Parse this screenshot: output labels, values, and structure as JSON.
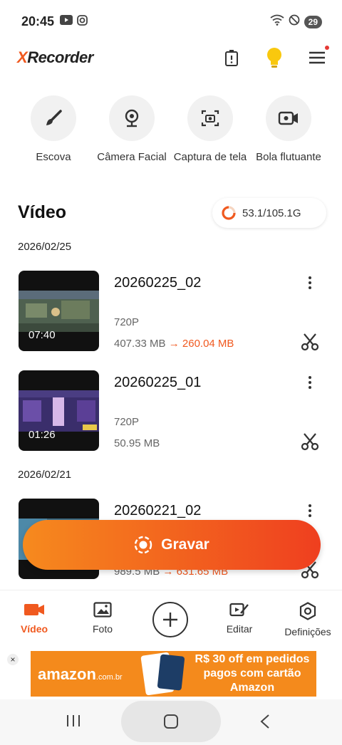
{
  "status_bar": {
    "time": "20:45",
    "battery": "29"
  },
  "app": {
    "logo_x": "X",
    "logo_rest": "Recorder"
  },
  "tools": [
    {
      "label": "Escova",
      "icon": "brush-icon"
    },
    {
      "label": "Câmera Facial",
      "icon": "webcam-icon"
    },
    {
      "label": "Captura de tela",
      "icon": "screenshot-icon"
    },
    {
      "label": "Bola flutuante",
      "icon": "floating-camera-icon"
    }
  ],
  "section": {
    "title": "Vídeo",
    "storage": "53.1/105.1G"
  },
  "groups": [
    {
      "date": "2026/02/25",
      "videos": [
        {
          "name": "20260225_02",
          "duration": "07:40",
          "resolution": "720P",
          "size": "407.33 MB",
          "arrow": "→",
          "compressed": "260.04 MB"
        },
        {
          "name": "20260225_01",
          "duration": "01:26",
          "resolution": "720P",
          "size": "50.95 MB"
        }
      ]
    },
    {
      "date": "2026/02/21",
      "videos": [
        {
          "name": "20260221_02",
          "size": "989.5 MB",
          "arrow": "→",
          "compressed": "631.65 MB"
        }
      ]
    }
  ],
  "record_button": {
    "label": "Gravar"
  },
  "bottom_nav": [
    {
      "label": "Vídeo",
      "icon": "video-camera-icon",
      "active": true
    },
    {
      "label": "Foto",
      "icon": "photo-icon"
    },
    {
      "label": "",
      "icon": "plus-icon"
    },
    {
      "label": "Editar",
      "icon": "edit-video-icon"
    },
    {
      "label": "Definições",
      "icon": "settings-hexagon-icon"
    }
  ],
  "ad": {
    "close": "×",
    "brand": "amazon",
    "brand_suffix": ".com.br",
    "text": "R$ 30 off em pedidos pagos com cartão Amazon"
  },
  "colors": {
    "accent": "#f0591f",
    "gradient_start": "#f68a1e",
    "gradient_end": "#ef3f1f"
  }
}
